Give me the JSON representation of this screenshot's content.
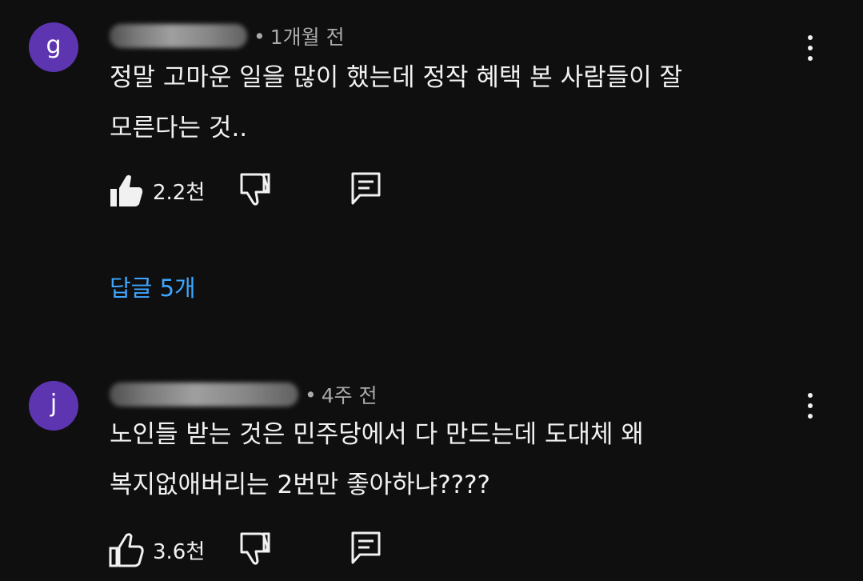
{
  "comments": [
    {
      "avatar_letter": "g",
      "avatar_color": "#5e35b1",
      "time": "1개월 전",
      "text": "정말 고마운 일을 많이 했는데 정작 혜택 본 사람들이 잘\n모른다는 것..",
      "like_count": "2.2천",
      "liked": true,
      "replies_label": "답글 5개"
    },
    {
      "avatar_letter": "j",
      "avatar_color": "#5e35b1",
      "time": "4주 전",
      "text": "노인들 받는 것은 민주당에서 다 만드는데 도대체 왜\n복지없애버리는 2번만 좋아하냐????",
      "like_count": "3.6천",
      "liked": false
    }
  ],
  "meta_separator": "•",
  "icons": {
    "like": "thumbs-up-icon",
    "dislike": "thumbs-down-icon",
    "reply": "reply-icon",
    "menu": "more-vertical-icon"
  },
  "colors": {
    "background": "#0f0f0f",
    "text": "#f1f1f1",
    "meta": "#aaaaaa",
    "link": "#3ea6ff"
  }
}
